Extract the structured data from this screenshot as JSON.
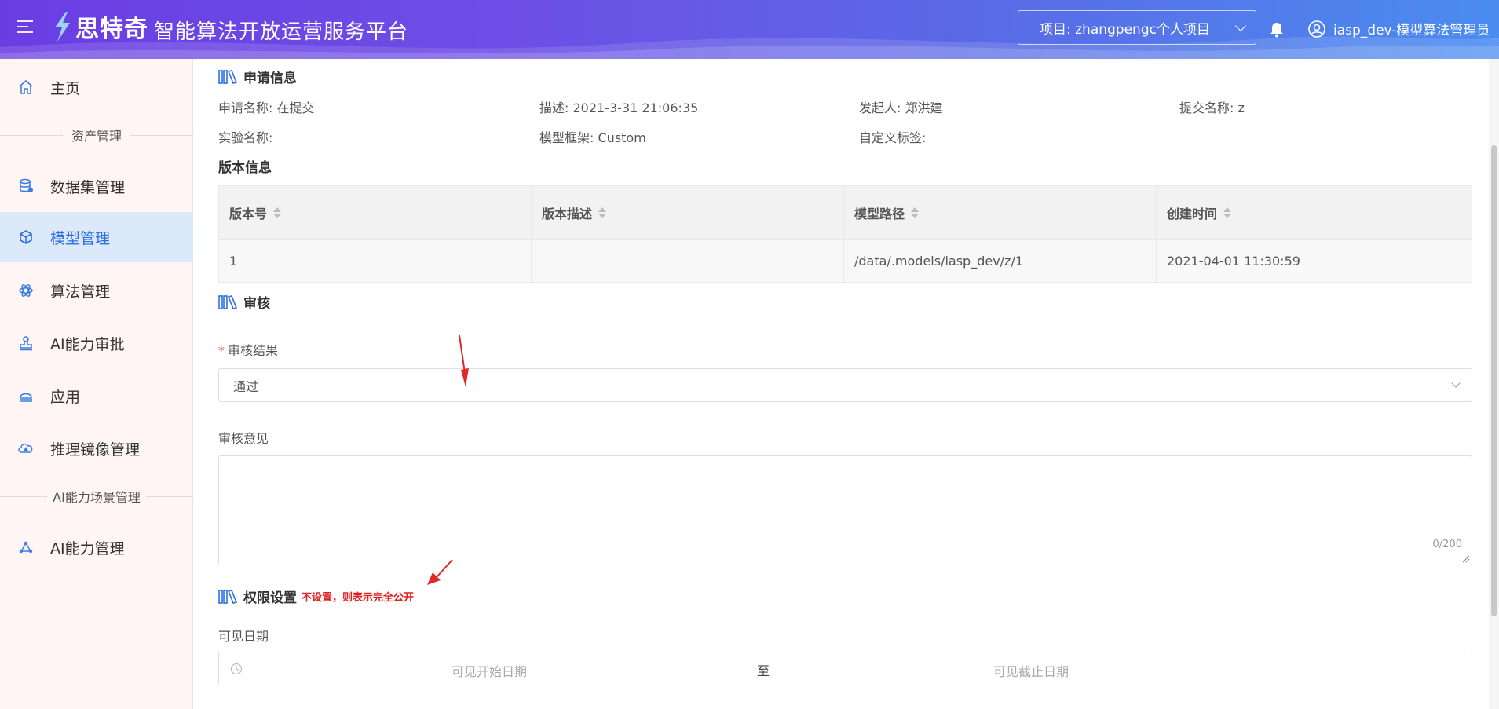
{
  "header": {
    "logo_text": "思特奇",
    "platform_title": "智能算法开放运营服务平台",
    "project_select": "项目: zhangpengc个人项目",
    "user_name": "iasp_dev-模型算法管理员"
  },
  "sidebar": {
    "items": [
      {
        "label": "主页",
        "icon": "home-icon"
      },
      {
        "label": "数据集管理",
        "icon": "database-icon"
      },
      {
        "label": "模型管理",
        "icon": "cube-icon"
      },
      {
        "label": "算法管理",
        "icon": "atom-icon"
      },
      {
        "label": "AI能力审批",
        "icon": "stamp-icon"
      },
      {
        "label": "应用",
        "icon": "app-icon"
      },
      {
        "label": "推理镜像管理",
        "icon": "cloud-icon"
      },
      {
        "label": "AI能力管理",
        "icon": "network-icon"
      }
    ],
    "groups": [
      "资产管理",
      "AI能力场景管理"
    ]
  },
  "application": {
    "title": "申请信息",
    "fields": [
      {
        "label": "申请名称:",
        "value": "在提交"
      },
      {
        "label": "描述:",
        "value": "2021-3-31 21:06:35"
      },
      {
        "label": "发起人:",
        "value": "郑洪建"
      },
      {
        "label": "提交名称:",
        "value": "z"
      },
      {
        "label": "实验名称:",
        "value": ""
      },
      {
        "label": "模型框架:",
        "value": "Custom"
      },
      {
        "label": "自定义标签:",
        "value": ""
      }
    ]
  },
  "version": {
    "title": "版本信息",
    "columns": [
      "版本号",
      "版本描述",
      "模型路径",
      "创建时间"
    ],
    "rows": [
      [
        "1",
        "",
        "/data/.models/iasp_dev/z/1",
        "2021-04-01 11:30:59"
      ]
    ]
  },
  "review": {
    "title": "审核",
    "result_label": "审核结果",
    "required_mark": "*",
    "result_value": "通过",
    "opinion_label": "审核意见",
    "opinion_value": "",
    "opinion_counter": "0/200"
  },
  "permission": {
    "title": "权限设置",
    "hint": "不设置，则表示完全公开",
    "date_label": "可见日期",
    "start_placeholder": "可见开始日期",
    "separator": "至",
    "end_placeholder": "可见截止日期"
  },
  "colors": {
    "accent": "#2f6fe0",
    "header_start": "#6a3de3",
    "header_end": "#4a8cf0",
    "hint": "#e02020",
    "sidebar_bg": "#fff5f4"
  }
}
